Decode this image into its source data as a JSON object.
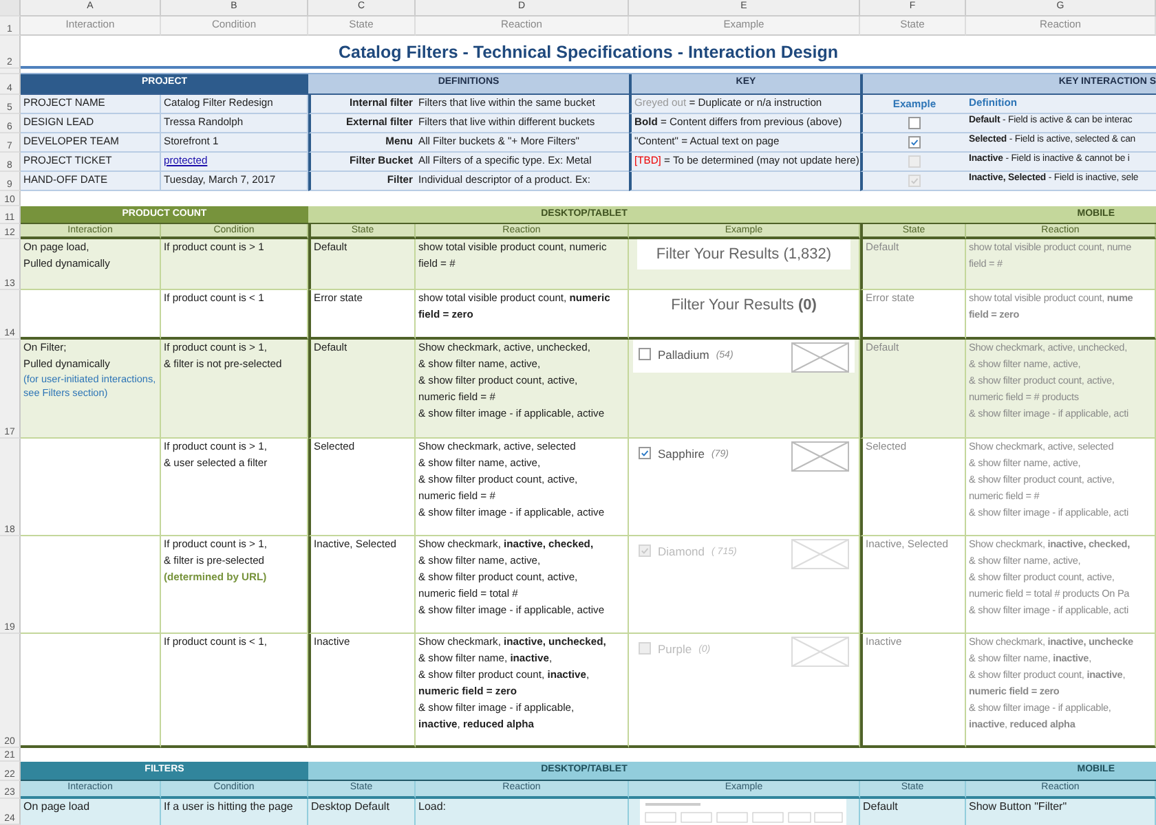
{
  "column_letters": [
    "A",
    "B",
    "C",
    "D",
    "E",
    "F",
    "G"
  ],
  "header_row": [
    "Interaction",
    "Condition",
    "State",
    "Reaction",
    "Example",
    "State",
    "Reaction"
  ],
  "title": "Catalog Filters - Technical Specifications - Interaction Design",
  "row_numbers": [
    "1",
    "2",
    "4",
    "5",
    "6",
    "7",
    "8",
    "9",
    "10",
    "11",
    "12",
    "13",
    "14",
    "17",
    "18",
    "19",
    "20",
    "21",
    "22",
    "23",
    "24"
  ],
  "project": {
    "header": "PROJECT",
    "items": [
      {
        "label": "PROJECT NAME",
        "value": "Catalog Filter Redesign",
        "kind": "text"
      },
      {
        "label": "DESIGN LEAD",
        "value": "Tressa Randolph",
        "kind": "text"
      },
      {
        "label": "DEVELOPER TEAM",
        "value": "Storefront 1",
        "kind": "text"
      },
      {
        "label": "PROJECT TICKET",
        "value": "protected",
        "kind": "link"
      },
      {
        "label": "HAND-OFF DATE",
        "value": "Tuesday, March 7, 2017",
        "kind": "text"
      }
    ]
  },
  "definitions": {
    "header": "DEFINITIONS",
    "items": [
      {
        "term": "Internal filter",
        "definition": "Filters that live within the same bucket"
      },
      {
        "term": "External filter",
        "definition": "Filters that live within different buckets"
      },
      {
        "term": "Menu",
        "definition": "All Filter buckets & \"+ More Filters\""
      },
      {
        "term": "Filter Bucket",
        "definition": "All Filters of a specific type. Ex: Metal"
      },
      {
        "term": "Filter",
        "definition": "Individual descriptor of a product. Ex:"
      }
    ]
  },
  "key": {
    "header": "KEY",
    "items": [
      {
        "label": "Greyed out",
        "kind": "grey",
        "text": "= Duplicate or n/a instruction"
      },
      {
        "label": "Bold",
        "kind": "bold",
        "text": "= Content differs from previous (above)"
      },
      {
        "label": "\"Content\"",
        "kind": "plain",
        "text": "= Actual text on page"
      },
      {
        "label": "[TBD]",
        "kind": "red",
        "text": "= To be determined (may not update here)"
      }
    ]
  },
  "key_interaction": {
    "header": "KEY INTERACTION S",
    "example_label": "Example",
    "definition_label": "Definition",
    "items": [
      {
        "checked": false,
        "disabled": false,
        "definition": "**Default** - Field is active & can be interac"
      },
      {
        "checked": true,
        "disabled": false,
        "definition": "**Selected** - Field is active, selected & can"
      },
      {
        "checked": false,
        "disabled": true,
        "definition": "**Inactive** - Field is inactive & cannot be i"
      },
      {
        "checked": true,
        "disabled": true,
        "definition": "**Inactive, Selected** - Field is inactive, sele"
      }
    ]
  },
  "product_count": {
    "header": "PRODUCT COUNT",
    "desktop_header": "DESKTOP/TABLET",
    "mobile_header": "MOBILE",
    "columns": [
      "Interaction",
      "Condition",
      "State",
      "Reaction",
      "Example",
      "State",
      "Reaction"
    ],
    "rows": [
      {
        "highlighted": true,
        "interaction": "On page load,\nPulled dynamically",
        "condition": "If product count is > 1",
        "state": "Default",
        "reaction": "show total visible product count, numeric\nfield = #",
        "example": {
          "kind": "count",
          "text": "Filter Your Results (1,832)"
        },
        "mobile_state": "Default",
        "mobile_reaction": "show total visible product count, nume\nfield = #"
      },
      {
        "highlighted": false,
        "condition": "If product count is < 1",
        "state": "Error state",
        "reaction": "show total visible product count, **numeric**\n**field = zero**",
        "example": {
          "kind": "count",
          "text": "Filter Your Results **(0)**"
        },
        "mobile_state": "Error state",
        "mobile_reaction": "show total visible product count, **nume**\n**field = zero**"
      },
      {
        "highlighted": true,
        "interaction": "On Filter;\nPulled dynamically",
        "interaction_note": "(for user-initiated interactions, see Filters section)",
        "condition": "If product count is > 1,\n& filter is not pre-selected",
        "state": "Default",
        "reaction": "Show checkmark, active, unchecked,\n& show filter name, active,\n& show filter product count, active,\nnumeric field = #\n& show filter image - if applicable, active",
        "example": {
          "kind": "filter_option",
          "name": "Palladium",
          "count": "(54)",
          "checked": false,
          "disabled": false
        },
        "mobile_state": "Default",
        "mobile_reaction": "Show checkmark, active, unchecked,\n& show filter name, active,\n& show filter product count, active,\nnumeric field = # products\n& show filter image - if applicable, acti"
      },
      {
        "highlighted": false,
        "condition": "If product count is > 1,\n& user selected a filter",
        "state": "Selected",
        "reaction": "Show checkmark, active, selected\n& show filter name, active,\n& show filter product count, active,\nnumeric field = #\n& show filter image - if applicable, active",
        "example": {
          "kind": "filter_option",
          "name": "Sapphire",
          "count": "(79)",
          "checked": true,
          "disabled": false
        },
        "mobile_state": "Selected",
        "mobile_reaction": "Show checkmark, active, selected\n& show filter name, active,\n& show filter product count, active,\nnumeric field = #\n& show filter image - if applicable, acti"
      },
      {
        "highlighted": false,
        "condition": "If product count is > 1,\n& filter is pre-selected",
        "condition_note": "(determined by URL)",
        "state": "Inactive, Selected",
        "reaction": "Show checkmark, **inactive, checked,**\n& show filter name, active,\n& show filter product count, active,\nnumeric field = total #\n& show filter image - if applicable, active",
        "example": {
          "kind": "filter_option",
          "name": "Diamond",
          "count": "( 715)",
          "checked": true,
          "disabled": true
        },
        "mobile_state": "Inactive, Selected",
        "mobile_reaction": "Show checkmark, **inactive, checked,**\n& show filter name, active,\n& show filter product count, active,\nnumeric field = total # products On Pa\n& show filter image - if applicable, acti"
      },
      {
        "highlighted": false,
        "condition": "If product count is < 1,",
        "state": "Inactive",
        "reaction": "Show checkmark, **inactive, unchecked,**\n& show filter name, **inactive**,\n& show filter product count, **inactive**,\n**numeric field = zero**\n& show filter image - if applicable,\n**inactive**, **reduced alpha**",
        "example": {
          "kind": "filter_option",
          "name": "Purple",
          "count": "(0)",
          "checked": false,
          "disabled": true
        },
        "mobile_state": "Inactive",
        "mobile_reaction": "Show checkmark, **inactive, unchecke**\n& show filter name, **inactive**,\n& show filter product count, **inactive**,\n**numeric field = zero**\n& show filter image - if applicable,\n**inactive**, **reduced alpha**"
      }
    ]
  },
  "filters": {
    "header": "FILTERS",
    "desktop_header": "DESKTOP/TABLET",
    "mobile_header": "MOBILE",
    "columns": [
      "Interaction",
      "Condition",
      "State",
      "Reaction",
      "Example",
      "State",
      "Reaction"
    ],
    "rows": [
      {
        "interaction": "On page load",
        "condition": "If a user is hitting the page",
        "state": "Desktop Default",
        "reaction": "Load:",
        "example": {
          "kind": "thumbnail"
        },
        "mobile_state": "Default",
        "mobile_reaction": "Show Button \"Filter\""
      }
    ]
  }
}
